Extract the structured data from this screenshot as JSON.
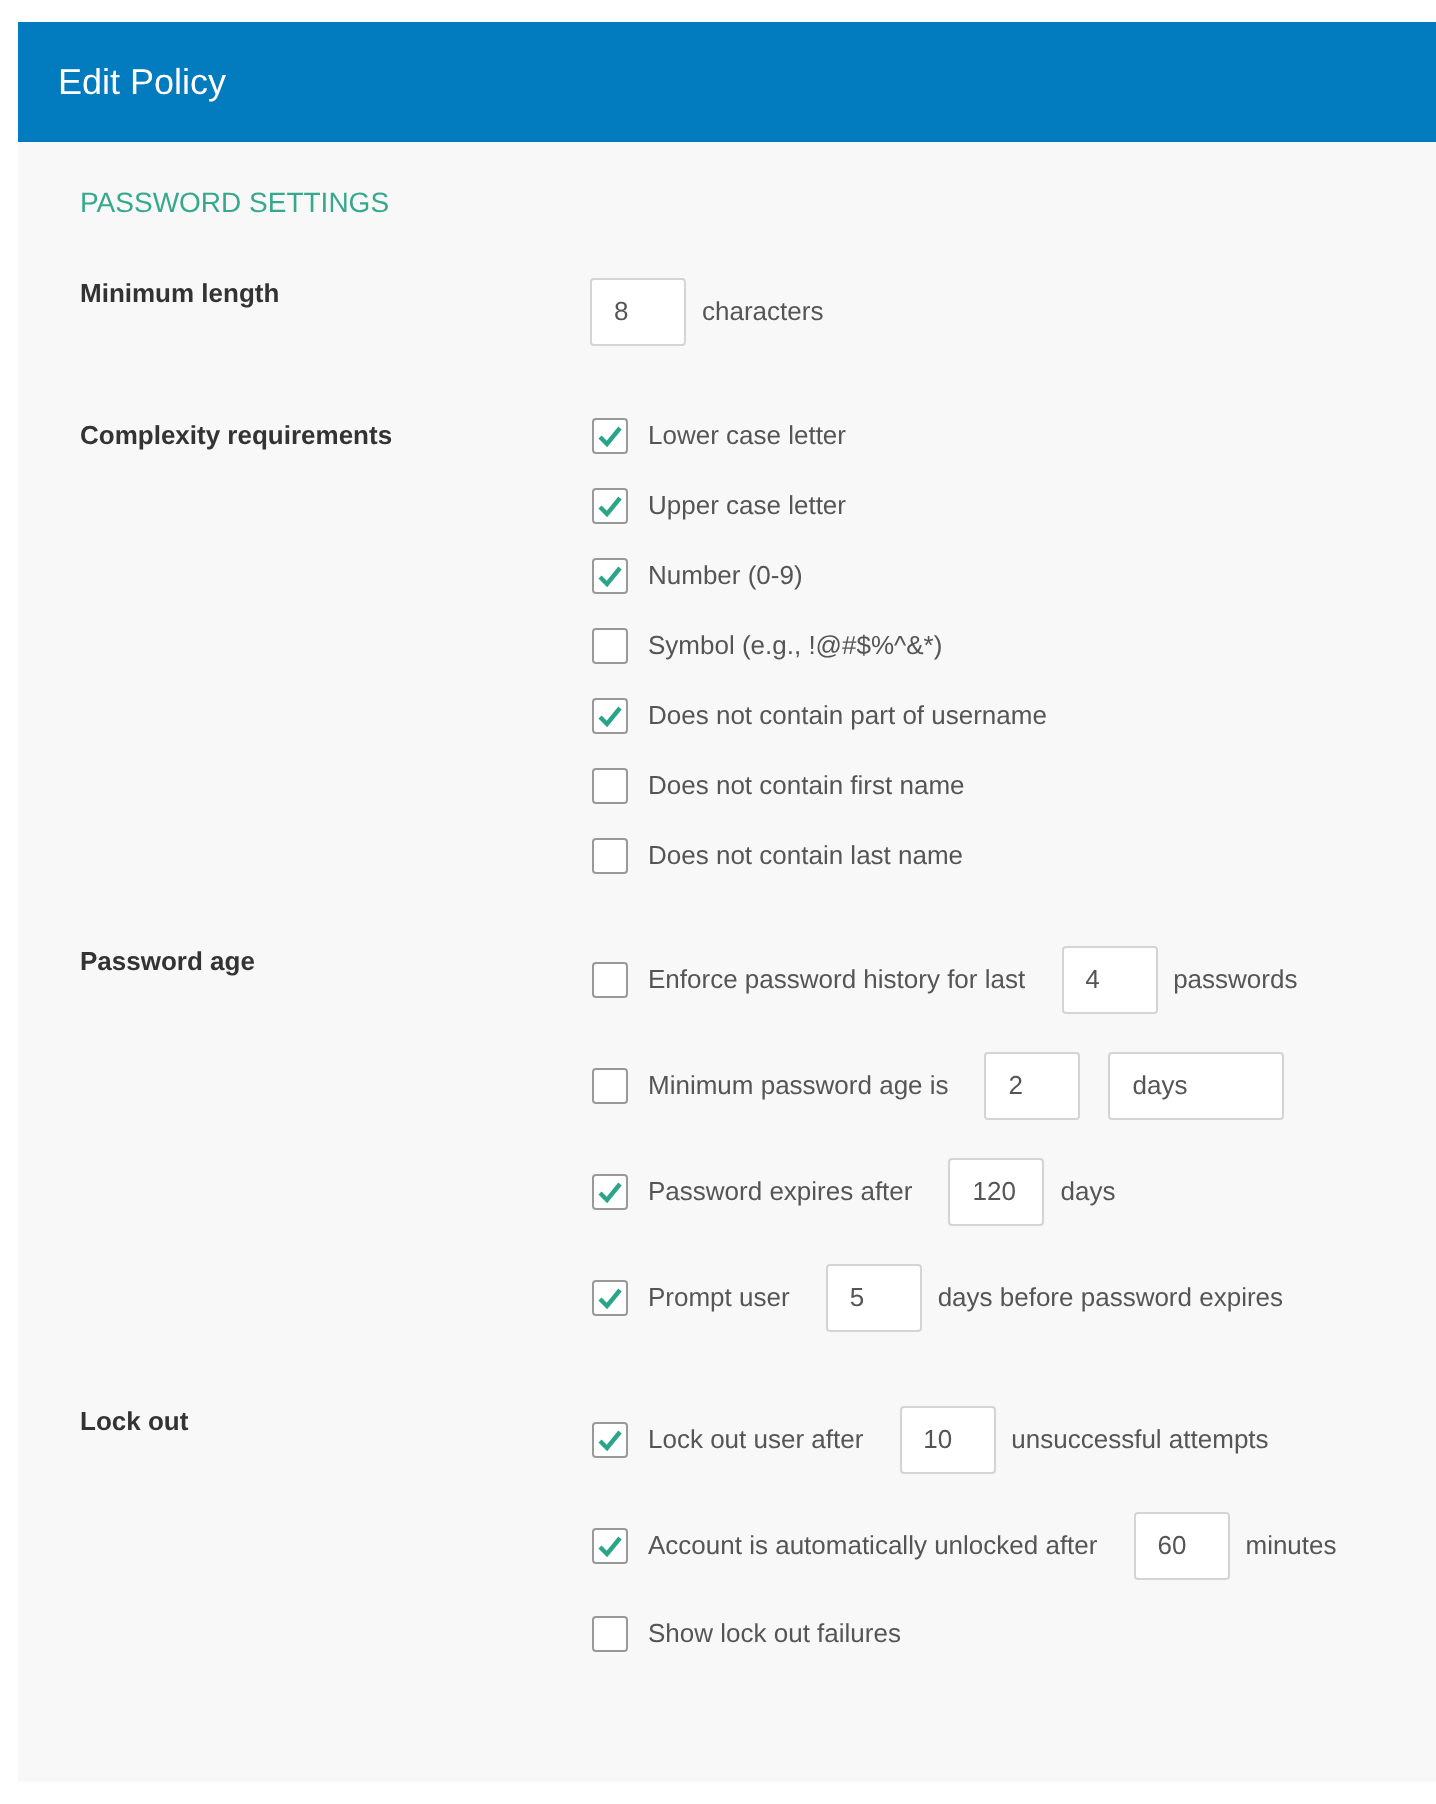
{
  "header": {
    "title": "Edit Policy"
  },
  "section_title": "PASSWORD SETTINGS",
  "groups": [
    {
      "label": "Minimum length",
      "rows": [
        {
          "parts": [
            {
              "kind": "field",
              "value": "8"
            },
            {
              "kind": "text",
              "text": "characters"
            }
          ]
        }
      ]
    },
    {
      "label": "Complexity requirements",
      "rows": [
        {
          "checked": true,
          "parts": [
            {
              "kind": "label",
              "text": "Lower case letter"
            }
          ]
        },
        {
          "checked": true,
          "parts": [
            {
              "kind": "label",
              "text": "Upper case letter"
            }
          ]
        },
        {
          "checked": true,
          "parts": [
            {
              "kind": "label",
              "text": "Number (0-9)"
            }
          ]
        },
        {
          "checked": false,
          "parts": [
            {
              "kind": "label",
              "text": "Symbol (e.g., !@#$%^&*)"
            }
          ]
        },
        {
          "checked": true,
          "parts": [
            {
              "kind": "label",
              "text": "Does not contain part of username"
            }
          ]
        },
        {
          "checked": false,
          "parts": [
            {
              "kind": "label",
              "text": "Does not contain first name"
            }
          ]
        },
        {
          "checked": false,
          "parts": [
            {
              "kind": "label",
              "text": "Does not contain last name"
            }
          ]
        }
      ]
    },
    {
      "label": "Password age",
      "rows": [
        {
          "checked": false,
          "parts": [
            {
              "kind": "label",
              "text": "Enforce password history for last"
            },
            {
              "kind": "field",
              "value": "4"
            },
            {
              "kind": "text",
              "text": "passwords"
            }
          ]
        },
        {
          "checked": false,
          "parts": [
            {
              "kind": "label",
              "text": "Minimum password age is"
            },
            {
              "kind": "field",
              "value": "2"
            },
            {
              "kind": "select",
              "value": "days"
            }
          ]
        },
        {
          "checked": true,
          "parts": [
            {
              "kind": "label",
              "text": "Password expires after"
            },
            {
              "kind": "field",
              "value": "120"
            },
            {
              "kind": "text",
              "text": "days"
            }
          ]
        },
        {
          "checked": true,
          "parts": [
            {
              "kind": "label",
              "text": "Prompt user"
            },
            {
              "kind": "field",
              "value": "5"
            },
            {
              "kind": "text",
              "text": "days before password expires"
            }
          ]
        }
      ]
    },
    {
      "label": "Lock out",
      "rows": [
        {
          "checked": true,
          "parts": [
            {
              "kind": "label",
              "text": "Lock out user after"
            },
            {
              "kind": "field",
              "value": "10"
            },
            {
              "kind": "text",
              "text": "unsuccessful attempts"
            }
          ]
        },
        {
          "checked": true,
          "parts": [
            {
              "kind": "label",
              "text": "Account is automatically unlocked after"
            },
            {
              "kind": "field",
              "value": "60"
            },
            {
              "kind": "text",
              "text": "minutes"
            }
          ]
        },
        {
          "checked": false,
          "parts": [
            {
              "kind": "label",
              "text": "Show lock out failures"
            }
          ]
        }
      ]
    }
  ]
}
